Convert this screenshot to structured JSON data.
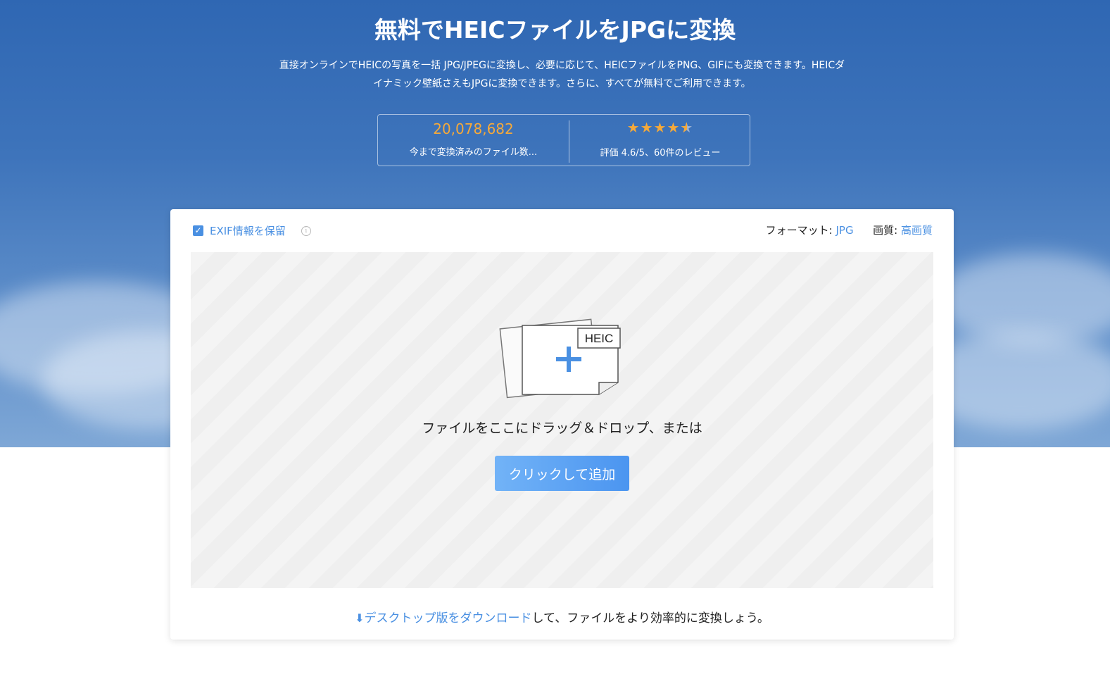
{
  "hero": {
    "title": "無料でHEICファイルをJPGに変換",
    "subtitle_line1": "直接オンラインでHEICの写真を一括 JPG/JPEGに変換し、必要に応じて、HEICファイルをPNG、GIFにも変換できます。HEICダ",
    "subtitle_line2": "イナミック壁紙さえもJPGに変換できます。さらに、すべてが無料でご利用できます。"
  },
  "stats": {
    "count": "20,078,682",
    "count_label": "今まで変換済みのファイル数...",
    "rating_stars": 4.6,
    "rating_label": "評価 4.6/5、60件のレビュー"
  },
  "options": {
    "exif_label": "EXIF情報を保留",
    "exif_checked": true,
    "format_label": "フォーマット:",
    "format_value": "JPG",
    "quality_label": "画質:",
    "quality_value": "高画質"
  },
  "dropzone": {
    "badge": "HEIC",
    "text": "ファイルをここにドラッグ＆ドロップ、または",
    "button_label": "クリックして追加"
  },
  "footer": {
    "download_link": "デスクトップ版をダウンロード",
    "rest": "して、ファイルをより効率的に変換しょう。"
  },
  "colors": {
    "accent": "#4a90e2",
    "count": "#f5a93a",
    "hero_top": "#2f67b3"
  }
}
